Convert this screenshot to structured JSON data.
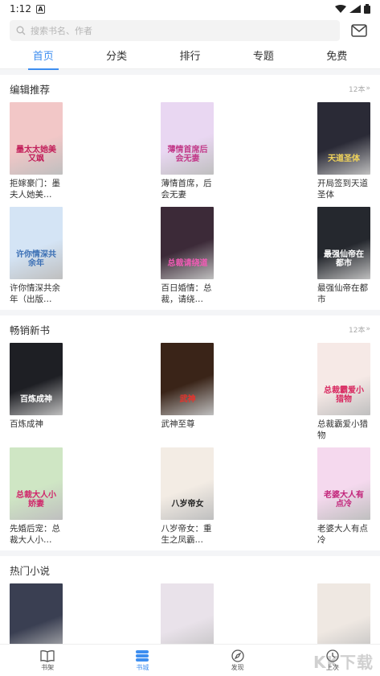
{
  "status": {
    "time": "1:12",
    "notif_letter": "A"
  },
  "search": {
    "placeholder": "搜索书名、作者"
  },
  "tabs": [
    {
      "label": "首页",
      "active": true
    },
    {
      "label": "分类"
    },
    {
      "label": "排行"
    },
    {
      "label": "专题"
    },
    {
      "label": "免费"
    }
  ],
  "sections": [
    {
      "title": "编辑推荐",
      "count": "12本",
      "books": [
        {
          "title": "拒嫁豪门：墨夫人她美…",
          "cover_title": "墨太太她美又飒",
          "color": "#f2c7c7",
          "ink": "#c21f5a"
        },
        {
          "title": "薄情首席，后会无妻",
          "cover_title": "薄情首席后会无妻",
          "color": "#e9d7f2",
          "ink": "#c23b8a"
        },
        {
          "title": "开局签到天道圣体",
          "cover_title": "天道圣体",
          "color": "#2a2a36",
          "ink": "#f0d35a"
        },
        {
          "title": "许你情深共余年（出版…",
          "cover_title": "许你情深共余年",
          "color": "#d4e4f5",
          "ink": "#3b6fb4"
        },
        {
          "title": "百日婚情：总裁，请绕…",
          "cover_title": "总裁请绕道",
          "color": "#3c2a38",
          "ink": "#f15bb5"
        },
        {
          "title": "最强仙帝在都市",
          "cover_title": "最强仙帝在都市",
          "color": "#25282e",
          "ink": "#ffffff"
        }
      ]
    },
    {
      "title": "畅销新书",
      "count": "12本",
      "books": [
        {
          "title": "百炼成神",
          "cover_title": "百炼成神",
          "color": "#1e1f24",
          "ink": "#ffffff"
        },
        {
          "title": "武神至尊",
          "cover_title": "武神",
          "color": "#3a2418",
          "ink": "#e8332c"
        },
        {
          "title": "总裁霸爱小猎物",
          "cover_title": "总裁霸爱小猎物",
          "color": "#f6e9e6",
          "ink": "#d8275f"
        },
        {
          "title": "先婚后宠：总裁大人小…",
          "cover_title": "总裁大人小娇妻",
          "color": "#cfe6c4",
          "ink": "#d0246a"
        },
        {
          "title": "八岁帝女：重生之凤霸…",
          "cover_title": "八岁帝女",
          "color": "#f3ece4",
          "ink": "#222222"
        },
        {
          "title": "老婆大人有点冷",
          "cover_title": "老婆大人有点冷",
          "color": "#f5d9ee",
          "ink": "#c2247a"
        }
      ]
    },
    {
      "title": "热门小说",
      "count": "",
      "books": [
        {
          "title": "",
          "cover_title": "",
          "color": "#3a3f52",
          "ink": "#ffffff"
        },
        {
          "title": "",
          "cover_title": "",
          "color": "#e9e2ea",
          "ink": "#333333"
        },
        {
          "title": "",
          "cover_title": "",
          "color": "#efe8e2",
          "ink": "#333333"
        }
      ]
    }
  ],
  "nav": [
    {
      "label": "书架",
      "icon": "book-icon"
    },
    {
      "label": "书城",
      "icon": "store-icon",
      "active": true
    },
    {
      "label": "发现",
      "icon": "compass-icon"
    },
    {
      "label": "上次",
      "icon": "clock-icon"
    }
  ],
  "accent": "#3d8ef0",
  "watermark": "KK下载"
}
